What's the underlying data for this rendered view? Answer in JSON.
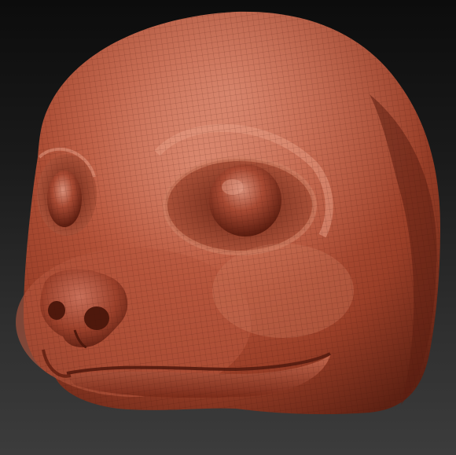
{
  "scene": {
    "subject": "sculpted-creature-head",
    "material_color": "#a8472f",
    "highlight_color": "#d98a6e",
    "shadow_color": "#5a1f12",
    "background_top": "#0c0c0c",
    "background_bottom": "#3c3c3c",
    "wireframe_visible": true
  }
}
